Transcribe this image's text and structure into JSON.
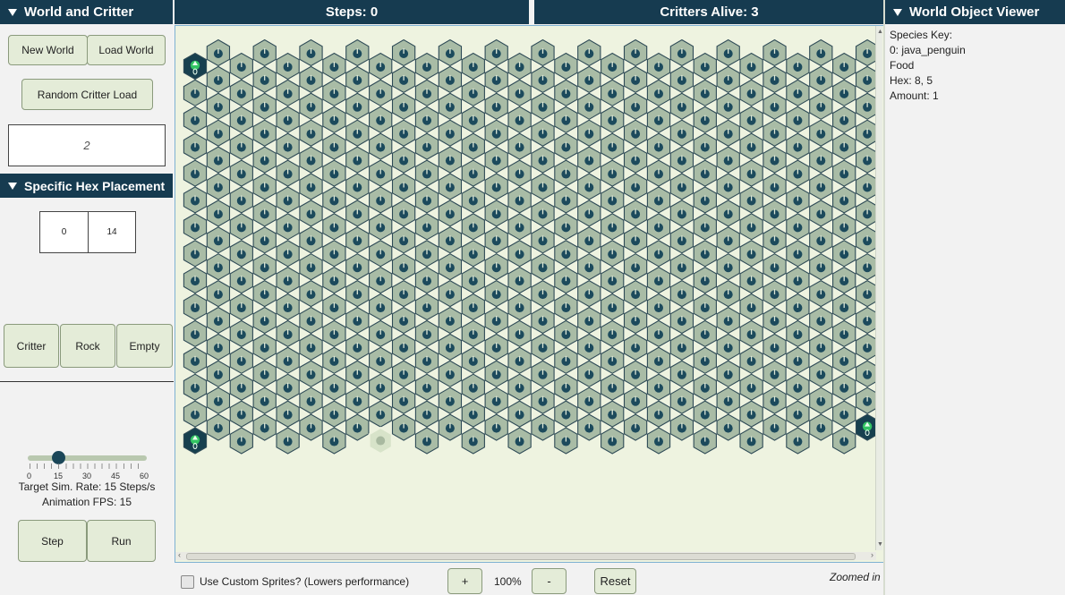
{
  "left_panel": {
    "title": "World and Critter",
    "new_world": "New World",
    "load_world": "Load World",
    "random_load": "Random Critter Load",
    "count_value": "2",
    "placement_title": "Specific Hex Placement",
    "hex_col": "0",
    "hex_row": "14",
    "critter": "Critter",
    "rock": "Rock",
    "empty": "Empty",
    "slider": {
      "value": 15,
      "min": 0,
      "max": 60,
      "ticks": [
        "0",
        "15",
        "30",
        "45",
        "60"
      ]
    },
    "rate_label": "Target Sim. Rate: 15 Steps/s",
    "fps_label": "Animation FPS: 15",
    "step": "Step",
    "run": "Run"
  },
  "header": {
    "steps": "Steps: 0",
    "critters_alive": "Critters Alive: 3"
  },
  "right_panel": {
    "title": "World Object Viewer",
    "lines": [
      "Species Key:",
      "0: java_penguin",
      "Food",
      "Hex: 8, 5",
      "Amount: 1"
    ]
  },
  "bottom_bar": {
    "custom_sprites": "Use Custom Sprites? (Lowers performance)",
    "plus": "+",
    "zoom": "100%",
    "minus": "-",
    "reset": "Reset",
    "status": "Zoomed in"
  },
  "colors": {
    "header_bg": "#163b50",
    "button_bg": "#e4ecd8",
    "hex_fill": "#a9bca6",
    "hex_stroke": "#2e4a56",
    "food_icon": "#1c4a5c",
    "critter_bg": "#17404f",
    "critter_green": "#33c463"
  }
}
